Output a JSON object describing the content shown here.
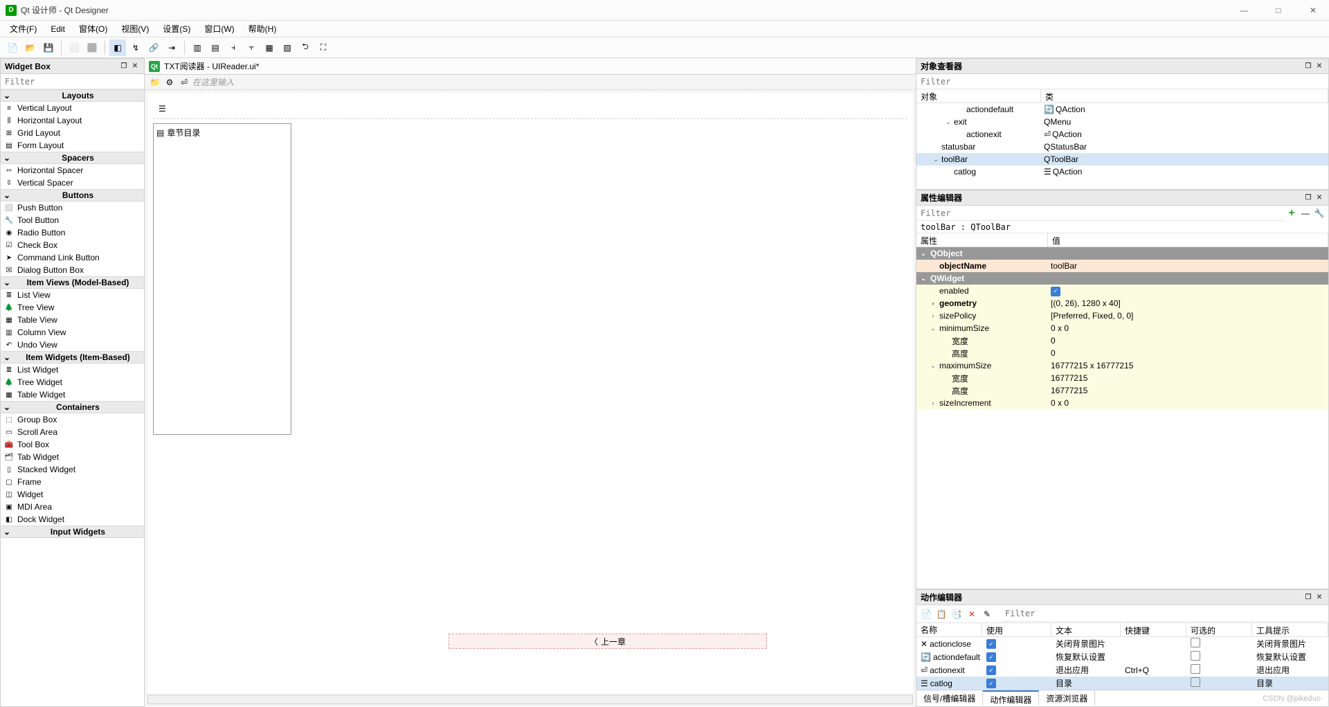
{
  "window": {
    "title": "Qt 设计师 - Qt Designer"
  },
  "menu": [
    "文件(F)",
    "Edit",
    "窗体(O)",
    "视图(V)",
    "设置(S)",
    "窗口(W)",
    "帮助(H)"
  ],
  "widget_box": {
    "title": "Widget Box",
    "filter_placeholder": "Filter",
    "groups": [
      {
        "name": "Layouts",
        "items": [
          "Vertical Layout",
          "Horizontal Layout",
          "Grid Layout",
          "Form Layout"
        ]
      },
      {
        "name": "Spacers",
        "items": [
          "Horizontal Spacer",
          "Vertical Spacer"
        ]
      },
      {
        "name": "Buttons",
        "items": [
          "Push Button",
          "Tool Button",
          "Radio Button",
          "Check Box",
          "Command Link Button",
          "Dialog Button Box"
        ]
      },
      {
        "name": "Item Views (Model-Based)",
        "items": [
          "List View",
          "Tree View",
          "Table View",
          "Column View",
          "Undo View"
        ]
      },
      {
        "name": "Item Widgets (Item-Based)",
        "items": [
          "List Widget",
          "Tree Widget",
          "Table Widget"
        ]
      },
      {
        "name": "Containers",
        "items": [
          "Group Box",
          "Scroll Area",
          "Tool Box",
          "Tab Widget",
          "Stacked Widget",
          "Frame",
          "Widget",
          "MDI Area",
          "Dock Widget"
        ]
      },
      {
        "name": "Input Widgets",
        "items": []
      }
    ]
  },
  "doc": {
    "title": "TXT阅读器 - UIReader.ui*",
    "toolbar_hint": "在这里输入",
    "list_header": "章节目录",
    "prev_button": "上一章"
  },
  "object_inspector": {
    "title": "对象查看器",
    "filter_placeholder": "Filter",
    "headers": [
      "对象",
      "类"
    ],
    "rows": [
      {
        "indent": 3,
        "name": "actiondefault",
        "cls": "QAction",
        "icon": "refresh"
      },
      {
        "indent": 2,
        "name": "exit",
        "cls": "QMenu",
        "expand": "v"
      },
      {
        "indent": 3,
        "name": "actionexit",
        "cls": "QAction",
        "icon": "exit"
      },
      {
        "indent": 1,
        "name": "statusbar",
        "cls": "QStatusBar"
      },
      {
        "indent": 1,
        "name": "toolBar",
        "cls": "QToolBar",
        "expand": "v",
        "selected": true
      },
      {
        "indent": 2,
        "name": "catlog",
        "cls": "QAction",
        "icon": "list"
      }
    ]
  },
  "property_editor": {
    "title": "属性编辑器",
    "filter_placeholder": "Filter",
    "object_label": "toolBar : QToolBar",
    "headers": [
      "属性",
      "值"
    ],
    "groups": [
      {
        "name": "QObject",
        "rows": [
          {
            "name": "objectName",
            "value": "toolBar",
            "bold": true,
            "bg": "o"
          }
        ]
      },
      {
        "name": "QWidget",
        "rows": [
          {
            "name": "enabled",
            "value": "",
            "check": true,
            "bg": "y"
          },
          {
            "name": "geometry",
            "value": "[(0, 26), 1280 x 40]",
            "bold": true,
            "arrow": ">",
            "bg": "y"
          },
          {
            "name": "sizePolicy",
            "value": "[Preferred, Fixed, 0, 0]",
            "arrow": ">",
            "bg": "y"
          },
          {
            "name": "minimumSize",
            "value": "0 x 0",
            "arrow": "v",
            "bg": "y"
          },
          {
            "name": "宽度",
            "value": "0",
            "indent": true,
            "bg": "y"
          },
          {
            "name": "高度",
            "value": "0",
            "indent": true,
            "bg": "y"
          },
          {
            "name": "maximumSize",
            "value": "16777215 x 16777215",
            "arrow": "v",
            "bg": "y"
          },
          {
            "name": "宽度",
            "value": "16777215",
            "indent": true,
            "bg": "y"
          },
          {
            "name": "高度",
            "value": "16777215",
            "indent": true,
            "bg": "y"
          },
          {
            "name": "sizeIncrement",
            "value": "0 x 0",
            "arrow": ">",
            "bg": "y"
          }
        ]
      }
    ]
  },
  "action_editor": {
    "title": "动作编辑器",
    "filter_placeholder": "Filter",
    "headers": [
      "名称",
      "使用",
      "文本",
      "快捷键",
      "可选的",
      "工具提示"
    ],
    "rows": [
      {
        "name": "actionclose",
        "use": true,
        "text": "关闭背景图片",
        "shortcut": "",
        "checkable": false,
        "tooltip": "关闭背景图片",
        "icon": "close"
      },
      {
        "name": "actiondefault",
        "use": true,
        "text": "恢复默认设置",
        "shortcut": "",
        "checkable": false,
        "tooltip": "恢复默认设置",
        "icon": "refresh"
      },
      {
        "name": "actionexit",
        "use": true,
        "text": "退出应用",
        "shortcut": "Ctrl+Q",
        "checkable": false,
        "tooltip": "退出应用",
        "icon": "exit"
      },
      {
        "name": "catlog",
        "use": true,
        "text": "目录",
        "shortcut": "",
        "checkable": false,
        "tooltip": "目录",
        "icon": "list",
        "selected": true
      }
    ],
    "tabs": [
      "信号/槽编辑器",
      "动作编辑器",
      "资源浏览器"
    ],
    "active_tab": 1
  },
  "watermark": "CSDN @pikeduo"
}
